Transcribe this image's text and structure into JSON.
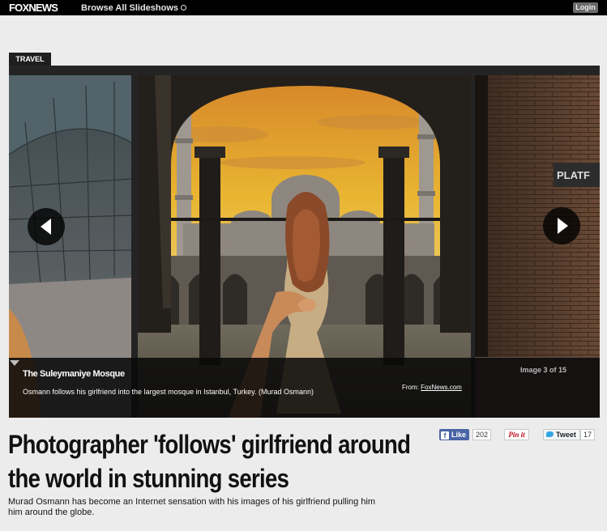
{
  "topbar": {
    "logo": "FOXNEWS",
    "browse_label": "Browse All Slideshows",
    "login_label": "Login"
  },
  "category_tab": "TRAVEL",
  "slideshow": {
    "caption_title": "The Suleymaniye Mosque",
    "caption_text": "Osmann follows his girlfriend into the largest mosque in Istanbul, Turkey. (Murad Osmann)",
    "counter": "Image 3 of 15",
    "source_prefix": "From:",
    "source_link": "FoxNews.com",
    "sky_top_color": "#e7b02c",
    "sky_bottom_color": "#f0d27a"
  },
  "article": {
    "headline_line1": "Photographer 'follows' girlfriend around",
    "headline_line2": "the world in stunning series",
    "deck_line1": "Murad Osmann has become an Internet sensation with his images of his girlfriend pulling him",
    "deck_line2": "him around the globe."
  },
  "social": {
    "fb_label": "Like",
    "fb_count": "202",
    "pin_label": "Pin it",
    "tweet_label": "Tweet",
    "tweet_count": "17"
  },
  "icons": {
    "prev": "chevron-left-icon",
    "next": "chevron-right-icon",
    "caption_toggle": "chevron-down-icon",
    "browse": "circle-arrow-icon"
  }
}
